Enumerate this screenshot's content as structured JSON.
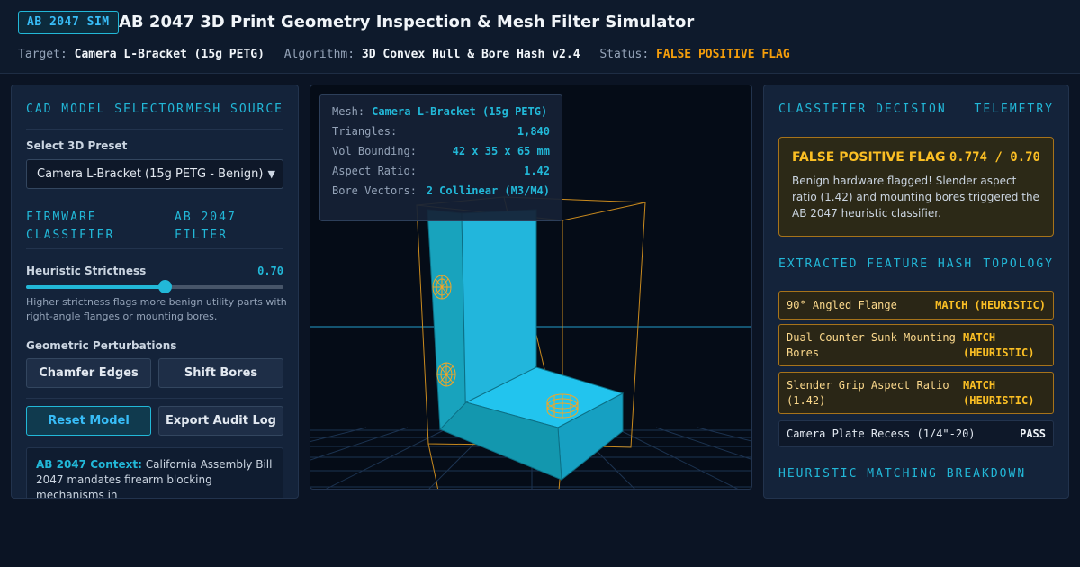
{
  "header": {
    "badge": "AB 2047 SIM",
    "title": "AB 2047 3D Print Geometry Inspection & Mesh Filter Simulator",
    "target_label": "Target:",
    "target_value": "Camera L-Bracket (15g PETG)",
    "algorithm_label": "Algorithm:",
    "algorithm_value": "3D Convex Hull & Bore Hash v2.4",
    "status_label": "Status:",
    "status_value": "FALSE POSITIVE FLAG"
  },
  "left": {
    "section1_title": "CAD MODEL SELECTOR",
    "section1_right": "MESH SOURCE",
    "preset_label": "Select 3D Preset",
    "preset_value": "Camera L-Bracket (15g PETG - Benign)",
    "section2_title_1": "FIRMWARE",
    "section2_title_2": "CLASSIFIER",
    "section2_right_1": "AB 2047",
    "section2_right_2": "FILTER",
    "strictness_label": "Heuristic Strictness",
    "strictness_value": "0.70",
    "strictness_level": 0.54,
    "strictness_help": "Higher strictness flags more benign utility parts with right-angle flanges or mounting bores.",
    "perturb_label": "Geometric Perturbations",
    "chamfer_label": "Chamfer Edges",
    "shift_label": "Shift Bores",
    "reset_label": "Reset Model",
    "export_label": "Export Audit Log",
    "context_title": "AB 2047 Context:",
    "context_text": "California Assembly Bill 2047 mandates firearm blocking mechanisms in"
  },
  "viewport": {
    "mesh_label": "Mesh:",
    "mesh_value": "Camera L-Bracket (15g PETG)",
    "triangles_label": "Triangles:",
    "triangles_value": "1,840",
    "vol_label": "Vol Bounding:",
    "vol_value": "42 x 35 x 65 mm",
    "aspect_label": "Aspect Ratio:",
    "aspect_value": "1.42",
    "bore_label": "Bore Vectors:",
    "bore_value": "2 Collinear (M3/M4)"
  },
  "right": {
    "section1_title": "CLASSIFIER DECISION",
    "section1_right": "TELEMETRY",
    "decision_title": "FALSE POSITIVE FLAG",
    "decision_score": "0.774 / 0.70",
    "decision_text": "Benign hardware flagged! Slender aspect ratio (1.42) and mounting bores triggered the AB 2047 heuristic classifier.",
    "section2_title": "EXTRACTED FEATURE HASH",
    "section2_right": "TOPOLOGY",
    "features": [
      {
        "name": "90° Angled Flange",
        "result": "MATCH (HEURISTIC)"
      },
      {
        "name": "Dual Counter-Sunk Mounting Bores",
        "result": "MATCH (HEURISTIC)"
      },
      {
        "name": "Slender Grip Aspect Ratio (1.42)",
        "result": "MATCH (HEURISTIC)"
      },
      {
        "name": "Camera Plate Recess (1/4\"-20)",
        "result": "PASS"
      }
    ],
    "section3_title": "HEURISTIC MATCHING BREAKDOWN"
  },
  "colors": {
    "accent": "#22b8d8",
    "warning": "#f59e0b",
    "background": "#0b1424"
  }
}
